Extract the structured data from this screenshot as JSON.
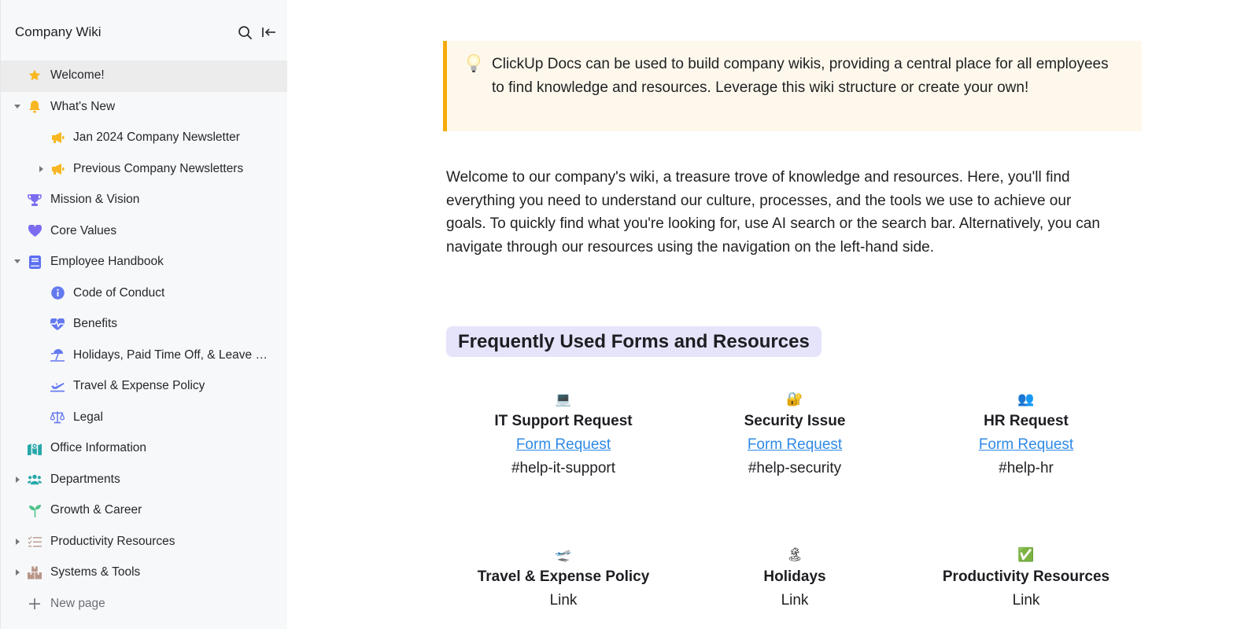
{
  "sidebar": {
    "title": "Company Wiki",
    "search_icon": "search-icon",
    "collapse_icon": "collapse-sidebar-icon",
    "items": [
      {
        "label": "Welcome!",
        "icon": "star-icon",
        "level": 0,
        "chevron": "none",
        "active": true
      },
      {
        "label": "What's New",
        "icon": "bell-icon",
        "level": 0,
        "chevron": "down"
      },
      {
        "label": "Jan 2024 Company Newsletter",
        "icon": "megaphone-icon",
        "level": 1,
        "chevron": "none"
      },
      {
        "label": "Previous Company Newsletters",
        "icon": "megaphone-icon",
        "level": 1,
        "chevron": "right"
      },
      {
        "label": "Mission & Vision",
        "icon": "trophy-icon",
        "level": 0,
        "chevron": "none"
      },
      {
        "label": "Core Values",
        "icon": "heart-icon",
        "level": 0,
        "chevron": "none"
      },
      {
        "label": "Employee Handbook",
        "icon": "book-icon",
        "level": 0,
        "chevron": "down"
      },
      {
        "label": "Code of Conduct",
        "icon": "info-icon",
        "level": 1,
        "chevron": "none"
      },
      {
        "label": "Benefits",
        "icon": "heartbeat-icon",
        "level": 1,
        "chevron": "none"
      },
      {
        "label": "Holidays, Paid Time Off, & Leave Policy",
        "icon": "beach-umbrella-icon",
        "level": 1,
        "chevron": "none"
      },
      {
        "label": "Travel & Expense Policy",
        "icon": "airplane-icon",
        "level": 1,
        "chevron": "none"
      },
      {
        "label": "Legal",
        "icon": "scale-icon",
        "level": 1,
        "chevron": "none"
      },
      {
        "label": "Office Information",
        "icon": "map-icon",
        "level": 0,
        "chevron": "none"
      },
      {
        "label": "Departments",
        "icon": "users-icon",
        "level": 0,
        "chevron": "right"
      },
      {
        "label": "Growth & Career",
        "icon": "sprout-icon",
        "level": 0,
        "chevron": "right"
      },
      {
        "label": "Productivity Resources",
        "icon": "checklist-icon",
        "level": 0,
        "chevron": "right"
      },
      {
        "label": "Systems & Tools",
        "icon": "boxes-icon",
        "level": 0,
        "chevron": "right"
      }
    ],
    "new_page_label": "New page"
  },
  "callout": {
    "icon": "lightbulb-icon",
    "text": "ClickUp Docs can be used to build company wikis, providing a central place for all employees to find knowledge and resources. Leverage this wiki structure or create your own!",
    "accent_color": "#f6ab0b",
    "background_color": "#fef8ec"
  },
  "intro": "Welcome to our company's wiki, a treasure trove of knowledge and resources. Here, you'll find everything you need to understand our culture, processes, and the tools we use to achieve our goals. To quickly find what you're looking for, use AI search or the search bar. Alternatively, you can navigate through our resources using the navigation on the left-hand side.",
  "section_heading": "Frequently Used Forms and Resources",
  "resources": [
    {
      "emoji": "💻",
      "icon": "laptop-icon",
      "title": "IT Support Request",
      "link": "Form Request",
      "channel": "#help-it-support"
    },
    {
      "emoji": "🔐",
      "icon": "lock-key-icon",
      "title": "Security Issue",
      "link": "Form Request",
      "channel": "#help-security"
    },
    {
      "emoji": "👥",
      "icon": "people-icon",
      "title": "HR Request",
      "link": "Form Request",
      "channel": "#help-hr"
    },
    {
      "emoji": "🛫",
      "icon": "airplane-departure-icon",
      "title": "Travel & Expense Policy",
      "link": "Link"
    },
    {
      "emoji": "🏝",
      "icon": "island-icon",
      "title": "Holidays",
      "link": "Link"
    },
    {
      "emoji": "✅",
      "icon": "check-mark-icon",
      "title": "Productivity Resources",
      "link": "Link"
    }
  ],
  "colors": {
    "link": "#2f8ae5",
    "heading_highlight": "#e5e4fb",
    "sidebar_bg": "#f7f8fa",
    "active_item_bg": "#ececed"
  }
}
